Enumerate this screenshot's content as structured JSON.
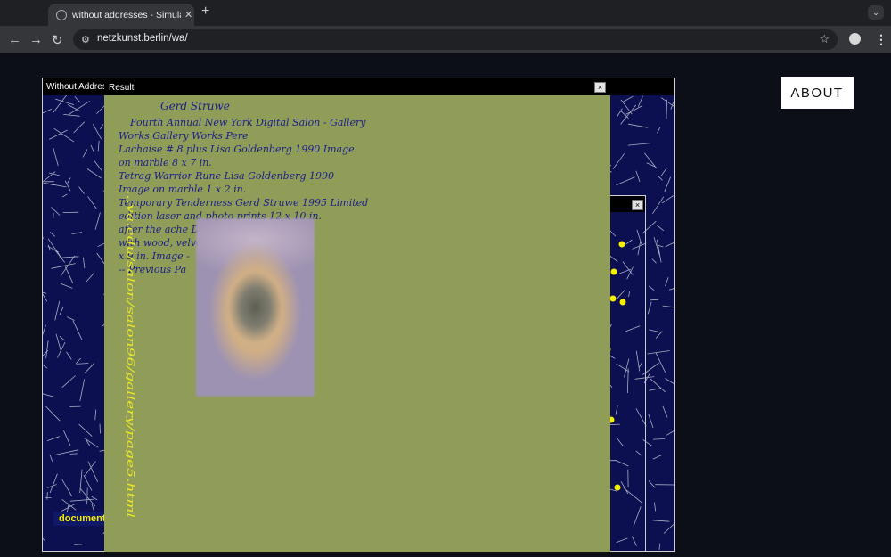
{
  "browser": {
    "tab_title": "without addresses - Simulatio",
    "tab_close": "✕",
    "new_tab": "+",
    "dropdown": "⌄",
    "url": "netzkunst.berlin/wa/",
    "back": "←",
    "forward": "→",
    "reload": "↻",
    "star": "☆",
    "menu": "⋮",
    "site_info": "⚙"
  },
  "page": {
    "about_label": "ABOUT",
    "main_window_title": "Without Addres",
    "documentation_link": "document",
    "result_window_title": "Result",
    "close_glyph": "×"
  },
  "result": {
    "lines": [
      "Gerd Struwe",
      "Fourth Annual New York Digital Salon - Gallery",
      "Works          Gallery Works          Pere",
      "Lachaise # 8 plus    Lisa Goldenberg    1990    Image",
      "on marble    8 x 7 in.",
      "Tetrag Warrior Rune    Lisa Goldenberg    1990",
      "Image on marble    1 x 2 in.",
      "Temporary Tenderness    Gerd Struwe    1995    Limited",
      "edition laser and photo prints    12 x 10 in.",
      "after the ache                                    Duratran",
      "with wood, velvet                              60 x 18",
      "x 9 in.                                        Image -",
      "-- Previous Pa"
    ],
    "vertical_url": "...va.edu/salon/salon96/gallery/page5.html"
  },
  "colors": {
    "result_bg": "#909d58",
    "script_ink": "#1b1e8a",
    "map_bg": "#0c1050",
    "map_lines": "#c8c8d8",
    "marker": "#f6f000"
  }
}
